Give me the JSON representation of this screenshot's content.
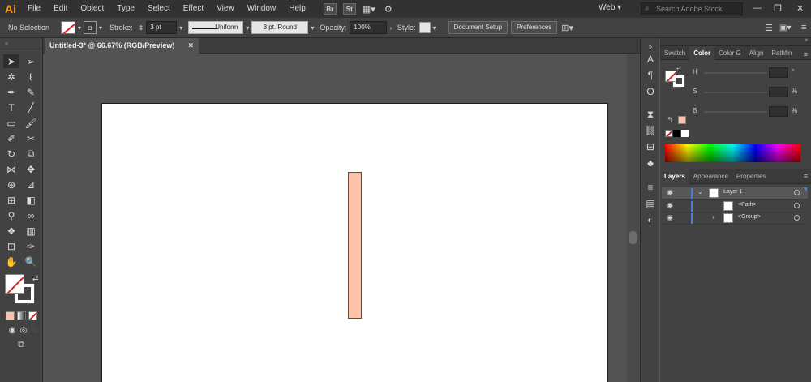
{
  "menubar": {
    "logo": "Ai",
    "items": [
      "File",
      "Edit",
      "Object",
      "Type",
      "Select",
      "Effect",
      "View",
      "Window",
      "Help"
    ],
    "bridge": "Br",
    "stock": "St",
    "workspace": "Web",
    "search_placeholder": "Search Adobe Stock"
  },
  "control": {
    "selection": "No Selection",
    "stroke_label": "Stroke:",
    "stroke_value": "3 pt",
    "profile": "Uniform",
    "brush": "3 pt. Round",
    "opacity_label": "Opacity:",
    "opacity_value": "100%",
    "style_label": "Style:",
    "doc_setup": "Document Setup",
    "preferences": "Preferences"
  },
  "document": {
    "tab_title": "Untitled-3* @ 66.67% (RGB/Preview)",
    "shape_fill": "#fdc3a8"
  },
  "color_panel": {
    "tabs": [
      "Swatch",
      "Color",
      "Color G",
      "Align",
      "Pathfin"
    ],
    "active_tab": "Color",
    "channels": [
      {
        "label": "H",
        "unit": "°"
      },
      {
        "label": "S",
        "unit": "%"
      },
      {
        "label": "B",
        "unit": "%"
      }
    ]
  },
  "layers_panel": {
    "tabs": [
      "Layers",
      "Appearance",
      "Properties"
    ],
    "active_tab": "Layers",
    "rows": [
      {
        "name": "Layer 1"
      },
      {
        "name": "<Path>"
      },
      {
        "name": "<Group>"
      }
    ]
  },
  "colors": {
    "accent": "#ff9a00",
    "layer_highlight": "#4a7bd6"
  }
}
